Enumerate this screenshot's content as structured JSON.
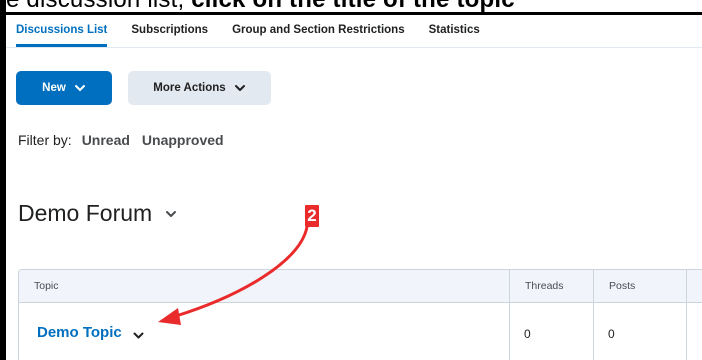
{
  "caption": {
    "left_text": "e discussion list,",
    "right_text": " click on the title of the topic"
  },
  "tabs": [
    {
      "label": "Discussions List",
      "active": true
    },
    {
      "label": "Subscriptions",
      "active": false
    },
    {
      "label": "Group and Section Restrictions",
      "active": false
    },
    {
      "label": "Statistics",
      "active": false
    }
  ],
  "toolbar": {
    "new_label": "New",
    "more_actions_label": "More Actions"
  },
  "filter": {
    "label": "Filter by:",
    "unread": "Unread",
    "unapproved": "Unapproved"
  },
  "forum": {
    "title": "Demo Forum"
  },
  "annotation": {
    "step_number": "2"
  },
  "table": {
    "headers": {
      "topic": "Topic",
      "threads": "Threads",
      "posts": "Posts"
    },
    "rows": [
      {
        "topic": "Demo Topic",
        "threads": "0",
        "posts": "0"
      }
    ]
  },
  "colors": {
    "accent": "#006fbf",
    "annotation": "#ea2b2b",
    "secondary_button": "#e3e9f1"
  },
  "icons": {
    "dropdown": "chevron-down-icon"
  }
}
